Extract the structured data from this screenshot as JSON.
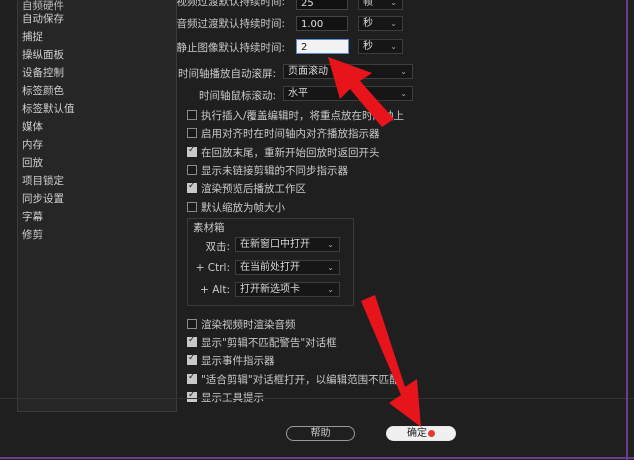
{
  "sidebar": {
    "items": [
      {
        "label": "自动保存"
      },
      {
        "label": "捕捉"
      },
      {
        "label": "操纵面板"
      },
      {
        "label": "设备控制"
      },
      {
        "label": "标签颜色"
      },
      {
        "label": "标签默认值"
      },
      {
        "label": "媒体"
      },
      {
        "label": "内存"
      },
      {
        "label": "回放"
      },
      {
        "label": "项目锁定"
      },
      {
        "label": "同步设置"
      },
      {
        "label": "字幕"
      },
      {
        "label": "修剪"
      }
    ],
    "partial_top": "自频硬件"
  },
  "settings": {
    "video_transition": {
      "label": "视频过渡默认持续时间:",
      "value": "25",
      "unit": "帧"
    },
    "audio_transition": {
      "label": "音频过渡默认持续时间:",
      "value": "1.00",
      "unit": "秒"
    },
    "still_image": {
      "label": "静止图像默认持续时间:",
      "value": "2",
      "unit": "秒"
    },
    "auto_scroll": {
      "label": "时间轴播放自动滚屏:",
      "value": "页面滚动"
    },
    "mouse_scroll": {
      "label": "时间轴鼠标滚动:",
      "value": "水平"
    }
  },
  "checkboxes": [
    {
      "label": "执行插入/覆盖编辑时，将重点放在时间轴上",
      "checked": false
    },
    {
      "label": "启用对齐时在时间轴内对齐播放指示器",
      "checked": false
    },
    {
      "label": "在回放末尾，重新开始回放时返回开头",
      "checked": true
    },
    {
      "label": "显示未链接剪辑的不同步指示器",
      "checked": false
    },
    {
      "label": "渲染预览后播放工作区",
      "checked": true
    },
    {
      "label": "默认缩放为帧大小",
      "checked": false
    }
  ],
  "bin": {
    "title": "素材箱",
    "rows": [
      {
        "label": "双击:",
        "value": "在新窗口中打开"
      },
      {
        "label": "+ Ctrl:",
        "value": "在当前处打开"
      },
      {
        "label": "+ Alt:",
        "value": "打开新选项卡"
      }
    ]
  },
  "checkboxes2": [
    {
      "label": "渲染视频时渲染音频",
      "checked": false
    },
    {
      "label": "显示\"剪辑不匹配警告\"对话框",
      "checked": true
    },
    {
      "label": "显示事件指示器",
      "checked": true
    },
    {
      "label": "\"适合剪辑\"对话框打开，以编辑范围不匹配",
      "checked": true
    },
    {
      "label": "显示工具提示",
      "checked": true
    }
  ],
  "buttons": {
    "help": "帮助",
    "ok": "确定"
  },
  "colors": {
    "accent": "#5b8dd6",
    "arrow": "#e8141c",
    "frame": "#6b3d8f"
  }
}
